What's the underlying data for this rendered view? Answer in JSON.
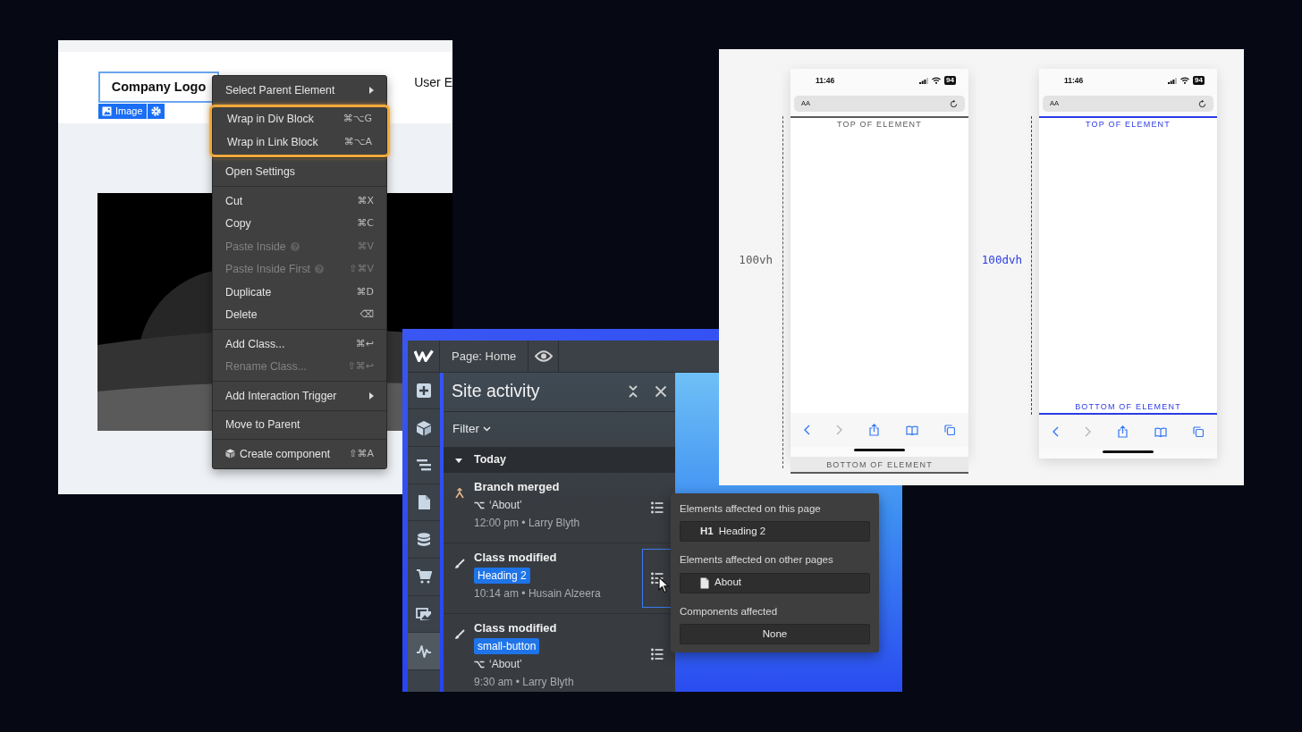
{
  "canvas_window": {
    "selected_element": "Company Logo",
    "element_tag": "Image",
    "nav_text": "User E",
    "context_menu": {
      "groups": [
        {
          "highlighted": false,
          "items": [
            {
              "kind": "submenu",
              "label": "Select Parent Element",
              "disabled": false,
              "help": false
            }
          ]
        },
        {
          "highlighted": true,
          "items": [
            {
              "kind": "action",
              "label": "Wrap in Div Block",
              "shortcut": "⌘⌥G",
              "disabled": false,
              "help": false
            },
            {
              "kind": "action",
              "label": "Wrap in Link Block",
              "shortcut": "⌘⌥A",
              "disabled": false,
              "help": false
            }
          ]
        },
        {
          "highlighted": false,
          "items": [
            {
              "kind": "action",
              "label": "Open Settings",
              "disabled": false,
              "help": false
            }
          ]
        },
        {
          "highlighted": false,
          "items": [
            {
              "kind": "action",
              "label": "Cut",
              "shortcut": "⌘X",
              "disabled": false,
              "help": false
            },
            {
              "kind": "action",
              "label": "Copy",
              "shortcut": "⌘C",
              "disabled": false,
              "help": false
            },
            {
              "kind": "action",
              "label": "Paste Inside",
              "shortcut": "⌘V",
              "disabled": true,
              "help": true
            },
            {
              "kind": "action",
              "label": "Paste Inside First",
              "shortcut": "⇧⌘V",
              "disabled": true,
              "help": true
            },
            {
              "kind": "action",
              "label": "Duplicate",
              "shortcut": "⌘D",
              "disabled": false,
              "help": false
            },
            {
              "kind": "action",
              "label": "Delete",
              "shortcut": "⌫",
              "disabled": false,
              "help": false
            }
          ]
        },
        {
          "highlighted": false,
          "items": [
            {
              "kind": "action",
              "label": "Add Class...",
              "shortcut": "⌘↩",
              "disabled": false,
              "help": false
            },
            {
              "kind": "action",
              "label": "Rename Class...",
              "shortcut": "⇧⌘↩",
              "disabled": true,
              "help": false
            }
          ]
        },
        {
          "highlighted": false,
          "items": [
            {
              "kind": "submenu",
              "label": "Add Interaction Trigger",
              "disabled": false,
              "help": false
            }
          ]
        },
        {
          "highlighted": false,
          "items": [
            {
              "kind": "action",
              "label": "Move to Parent",
              "disabled": false,
              "help": false
            }
          ]
        },
        {
          "highlighted": false,
          "items": [
            {
              "kind": "component",
              "label": "Create component",
              "shortcut": "⇧⌘A",
              "disabled": false,
              "help": false
            }
          ]
        }
      ]
    }
  },
  "viewport_comparison": {
    "phones": [
      {
        "kind": "overflow",
        "color": "#5a5a5a",
        "measure": "100vh",
        "time": "11:46",
        "battery": "94",
        "address_label": "AA",
        "top_label": "TOP OF ELEMENT",
        "bottom_label": "BOTTOM OF ELEMENT"
      },
      {
        "kind": "fit",
        "color": "#2b3be6",
        "measure": "100dvh",
        "time": "11:46",
        "battery": "94",
        "address_label": "AA",
        "top_label": "TOP OF ELEMENT",
        "bottom_label": "BOTTOM OF ELEMENT"
      }
    ]
  },
  "designer": {
    "page_label": "Page: Home",
    "sidebar": [
      {
        "kind": "add",
        "selected": false
      },
      {
        "kind": "components",
        "selected": false
      },
      {
        "kind": "navigator",
        "selected": false
      },
      {
        "kind": "pages",
        "selected": false
      },
      {
        "kind": "cms",
        "selected": false
      },
      {
        "kind": "ecommerce",
        "selected": false
      },
      {
        "kind": "assets",
        "selected": false
      },
      {
        "kind": "activity",
        "selected": true
      }
    ],
    "panel": {
      "title": "Site activity",
      "filter": "Filter",
      "group": "Today",
      "expanded": true,
      "entries": [
        {
          "kind": "branch",
          "title": "Branch merged",
          "branch": "‘About’",
          "meta": "12:00 pm • Larry Blyth",
          "selected": false
        },
        {
          "kind": "class",
          "title": "Class modified",
          "tag": "Heading 2",
          "meta": "10:14 am • Husain Alzeera",
          "selected": true
        },
        {
          "kind": "class",
          "title": "Class modified",
          "tag": "small-button",
          "branch": "‘About’",
          "meta": "9:30 am • Larry Blyth",
          "selected": false
        }
      ]
    },
    "popover": {
      "sections": [
        {
          "heading": "Elements affected on this page",
          "items": [
            {
              "kind": "element",
              "tag": "H1",
              "label": "Heading 2"
            }
          ]
        },
        {
          "heading": "Elements affected on other pages",
          "items": [
            {
              "kind": "page",
              "label": "About"
            }
          ]
        },
        {
          "heading": "Components affected",
          "items": [
            {
              "kind": "none",
              "label": "None"
            }
          ]
        }
      ]
    }
  }
}
